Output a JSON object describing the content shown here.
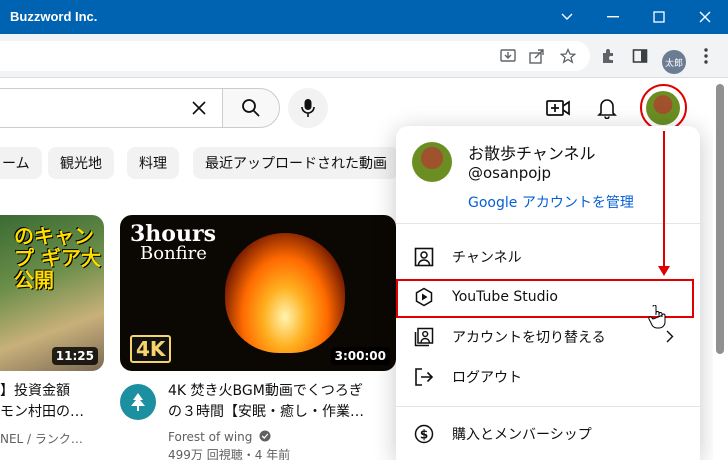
{
  "window": {
    "title": "Buzzword Inc."
  },
  "browser": {
    "profile_label": "太郎"
  },
  "chips": [
    "ーム",
    "観光地",
    "料理",
    "最近アップロードされた動画"
  ],
  "videos": [
    {
      "thumb_text": "のキャンプ ギア大公開",
      "duration": "11:25",
      "title_line1": "】投資金額",
      "title_line2": "モン村田の…",
      "meta1": "NEL / ランク…"
    },
    {
      "thumb_title": "3hours",
      "thumb_subtitle": "Bonfire",
      "badge": "4K",
      "duration": "3:00:00",
      "title_line1": "4K 焚き火BGM動画でくつろぎ",
      "title_line2": "の３時間【安眠・癒し・作業…",
      "channel": "Forest of wing",
      "stats": "499万 回視聴・4 年前"
    }
  ],
  "account_menu": {
    "name": "お散歩チャンネル",
    "handle": "@osanpojp",
    "manage_link": "Google アカウントを管理",
    "items": [
      {
        "label": "チャンネル",
        "icon": "person-box-icon"
      },
      {
        "label": "YouTube Studio",
        "icon": "studio-icon"
      },
      {
        "label": "アカウントを切り替える",
        "icon": "switch-account-icon"
      },
      {
        "label": "ログアウト",
        "icon": "logout-icon"
      },
      {
        "label": "購入とメンバーシップ",
        "icon": "dollar-icon"
      }
    ]
  },
  "colors": {
    "titlebar": "#0063b1",
    "annotation": "#e00000",
    "link": "#065fd4"
  }
}
